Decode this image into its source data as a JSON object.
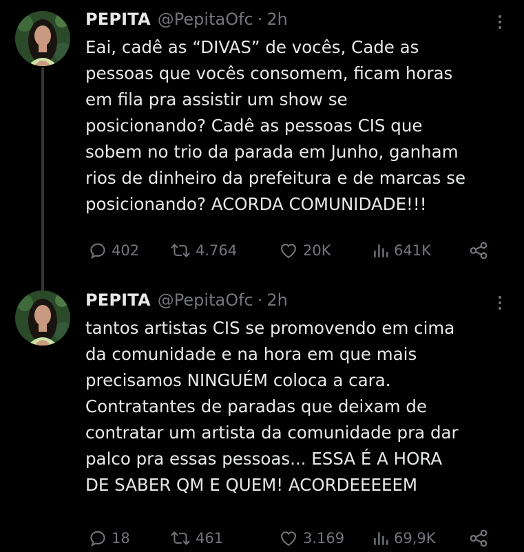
{
  "tweets": [
    {
      "display_name": "PEPITA",
      "handle": "@PepitaOfc",
      "separator": "·",
      "time": "2h",
      "text": "Eai, cadê as “DIVAS” de vocês, Cade as\npessoas que vocês consomem, ficam horas\nem fila pra assistir um show se\nposicionando? Cadê as pessoas CIS que\nsobem no trio da parada em Junho, ganham\nrios de dinheiro da prefeitura e de marcas se\nposicionando? ACORDA COMUNIDADE!!!",
      "replies": "402",
      "reposts": "4.764",
      "likes": "20K",
      "views": "641K"
    },
    {
      "display_name": "PEPITA",
      "handle": "@PepitaOfc",
      "separator": "·",
      "time": "2h",
      "text": "tantos artistas CIS se promovendo em cima\nda comunidade e na hora em que mais\nprecisamos NINGUÉM coloca a cara.\nContratantes de paradas que deixam de\ncontratar um artista da comunidade pra dar\npalco pra essas pessoas... ESSA É A HORA\nDE SABER QM E QUEM! ACORDEEEEEM",
      "replies": "18",
      "reposts": "461",
      "likes": "3.169",
      "views": "69,9K"
    }
  ],
  "icons": {
    "reply": "reply-icon",
    "repost": "repost-icon",
    "like": "heart-icon",
    "views": "views-icon",
    "share": "share-icon",
    "more": "more-icon"
  },
  "colors": {
    "background": "#000000",
    "text": "#e7e9ea",
    "muted": "#71767b",
    "thread_line": "#333639"
  }
}
